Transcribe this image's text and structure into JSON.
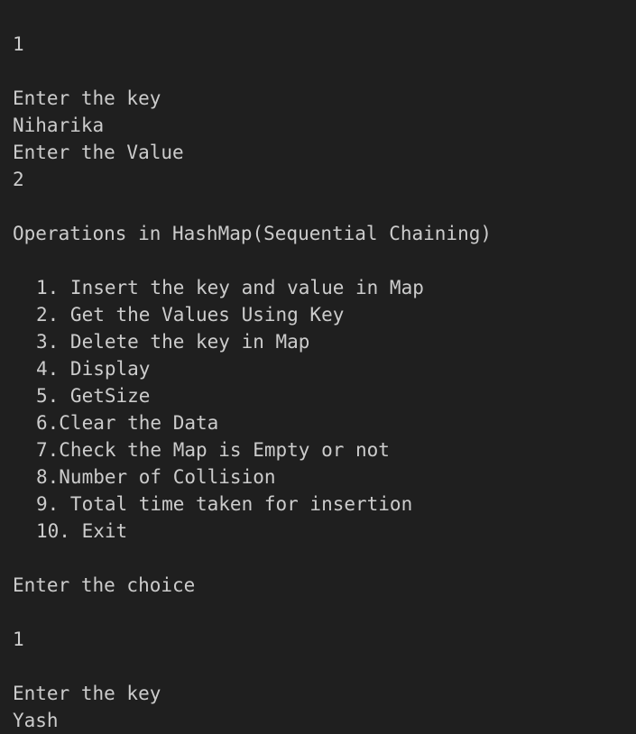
{
  "terminal": {
    "lines_top": [
      "1",
      "",
      "Enter the key",
      "Niharika",
      "Enter the Value",
      "2",
      ""
    ],
    "menu_title": "Operations in HashMap(Sequential Chaining)",
    "menu_items": [
      "1. Insert the key and value in Map",
      "2. Get the Values Using Key",
      "3. Delete the key in Map",
      "4. Display",
      "5. GetSize",
      "6.Clear the Data",
      "7.Check the Map is Empty or not",
      "8.Number of Collision",
      "9. Total time taken for insertion",
      "10. Exit"
    ],
    "choice_prompt": "Enter the choice",
    "choice_value": "1",
    "key_prompt": "Enter the key",
    "key_value": "Yash"
  }
}
